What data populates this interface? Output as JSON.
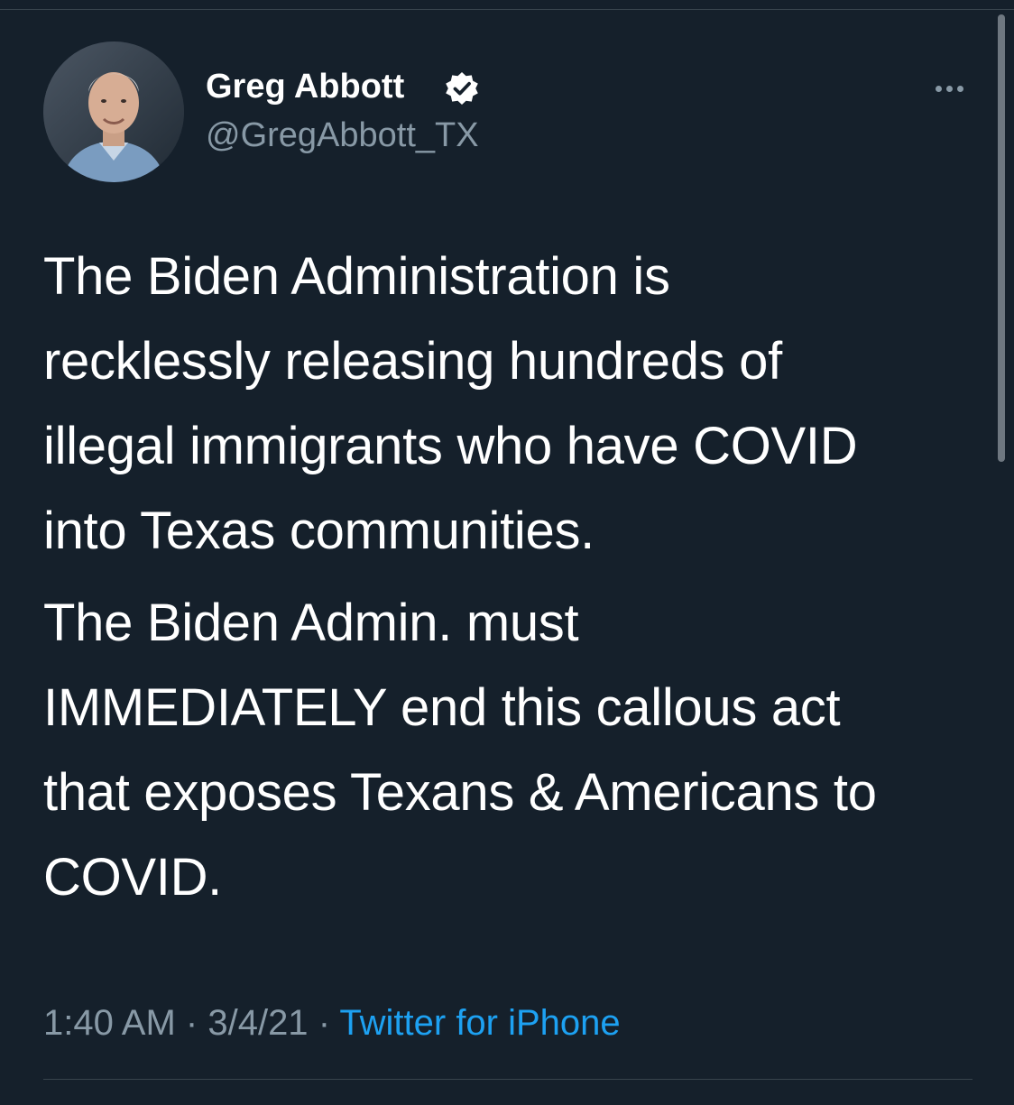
{
  "author": {
    "name": "Greg Abbott",
    "handle": "@GregAbbott_TX",
    "verified": true
  },
  "tweet": {
    "paragraphs": [
      "The Biden Administration is\nrecklessly releasing hundreds of\nillegal immigrants who have COVID\ninto Texas communities.",
      "The Biden Admin. must\nIMMEDIATELY end this callous act\nthat exposes Texans & Americans to\nCOVID."
    ]
  },
  "meta": {
    "time": "1:40 AM",
    "separator": "·",
    "date": "3/4/21",
    "source": "Twitter for iPhone"
  },
  "icons": {
    "verified": "verified-badge-icon",
    "more": "more-options-icon"
  },
  "colors": {
    "background": "#15202b",
    "text": "#ffffff",
    "secondary_text": "#8899a6",
    "link": "#1da1f2",
    "divider": "#38444d"
  }
}
